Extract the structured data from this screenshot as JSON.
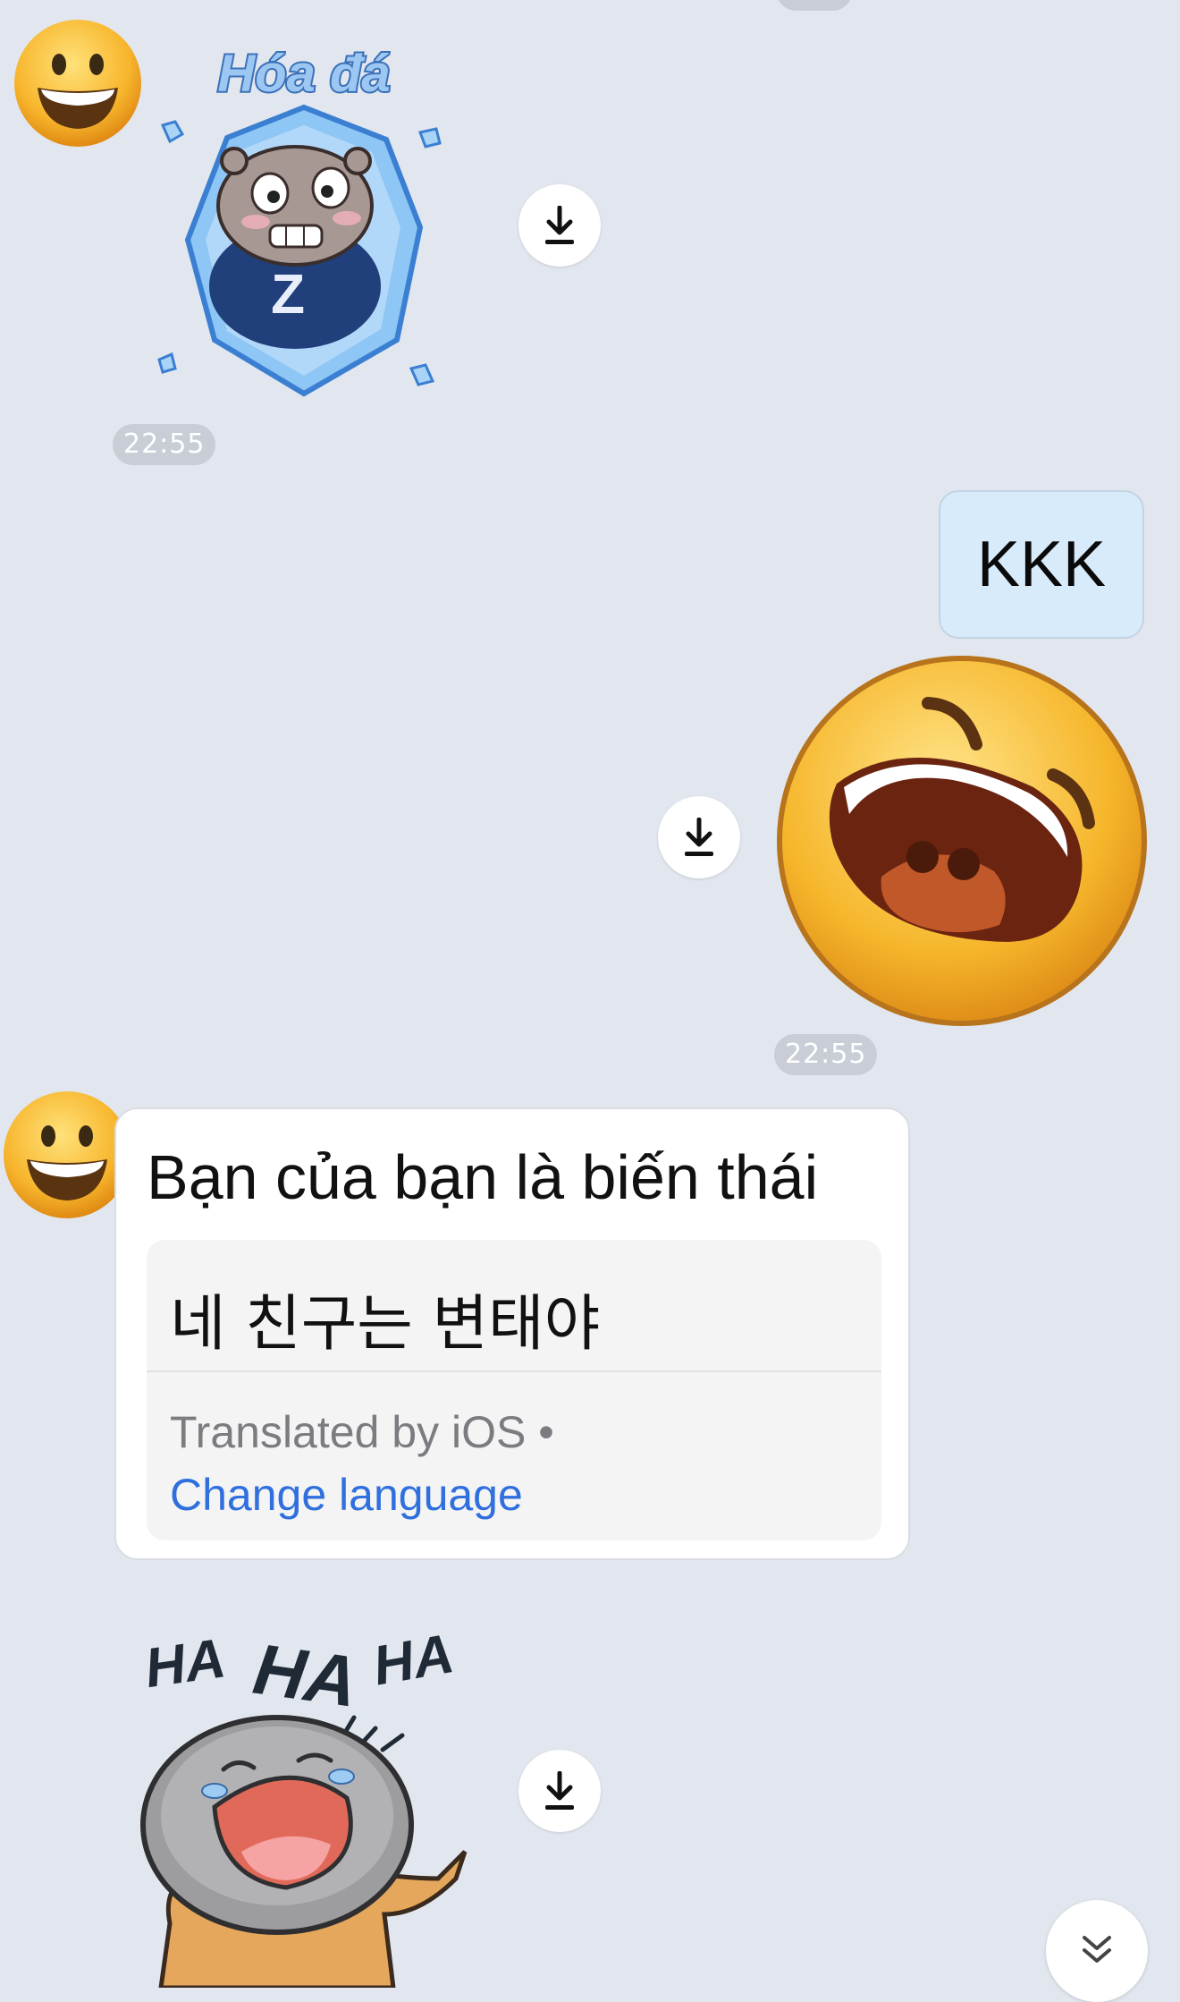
{
  "messages": {
    "sticker_ice": {
      "caption": "Hóa đá",
      "shirt_letter": "Z",
      "time": "22:55"
    },
    "outgoing_text": {
      "text": "KKK"
    },
    "outgoing_emoji": {
      "time": "22:55"
    },
    "incoming_text": {
      "text": "Bạn của bạn là biến thái",
      "translation": "네 친구는 변태야",
      "translated_by": "Translated by iOS •",
      "change_language": "Change language"
    },
    "sticker_laugh": {
      "text_1": "HA",
      "text_2": "HA",
      "text_3": "HA"
    }
  },
  "icons": {
    "download": "download-icon",
    "scroll_down": "double-chevron-down-icon",
    "avatar": "grinning-face-emoji"
  },
  "colors": {
    "background": "#e2e7ef",
    "outgoing_bubble": "#d8ebfb",
    "incoming_bubble": "#ffffff",
    "link": "#2f6fde",
    "time_pill": "#c9ced6"
  }
}
